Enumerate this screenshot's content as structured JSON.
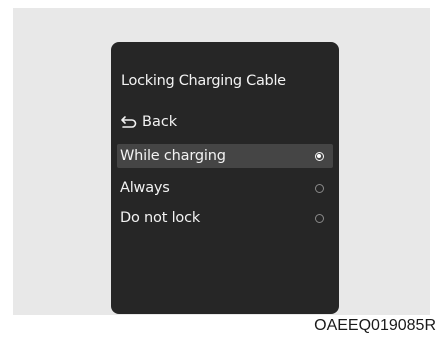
{
  "screen": {
    "title": "Locking Charging Cable",
    "back_label": "Back",
    "options": [
      {
        "label": "While charging",
        "selected": true
      },
      {
        "label": "Always",
        "selected": false
      },
      {
        "label": "Do not lock",
        "selected": false
      }
    ]
  },
  "caption": "OAEEQ019085R",
  "icons": {
    "back": "back-arrow-icon",
    "radio_on": "radio-selected-icon",
    "radio_off": "radio-unselected-icon"
  },
  "colors": {
    "screen_bg": "#262626",
    "highlight_bg": "#454545",
    "text": "#f2f2f2",
    "frame_bg": "#e8e8e8"
  }
}
